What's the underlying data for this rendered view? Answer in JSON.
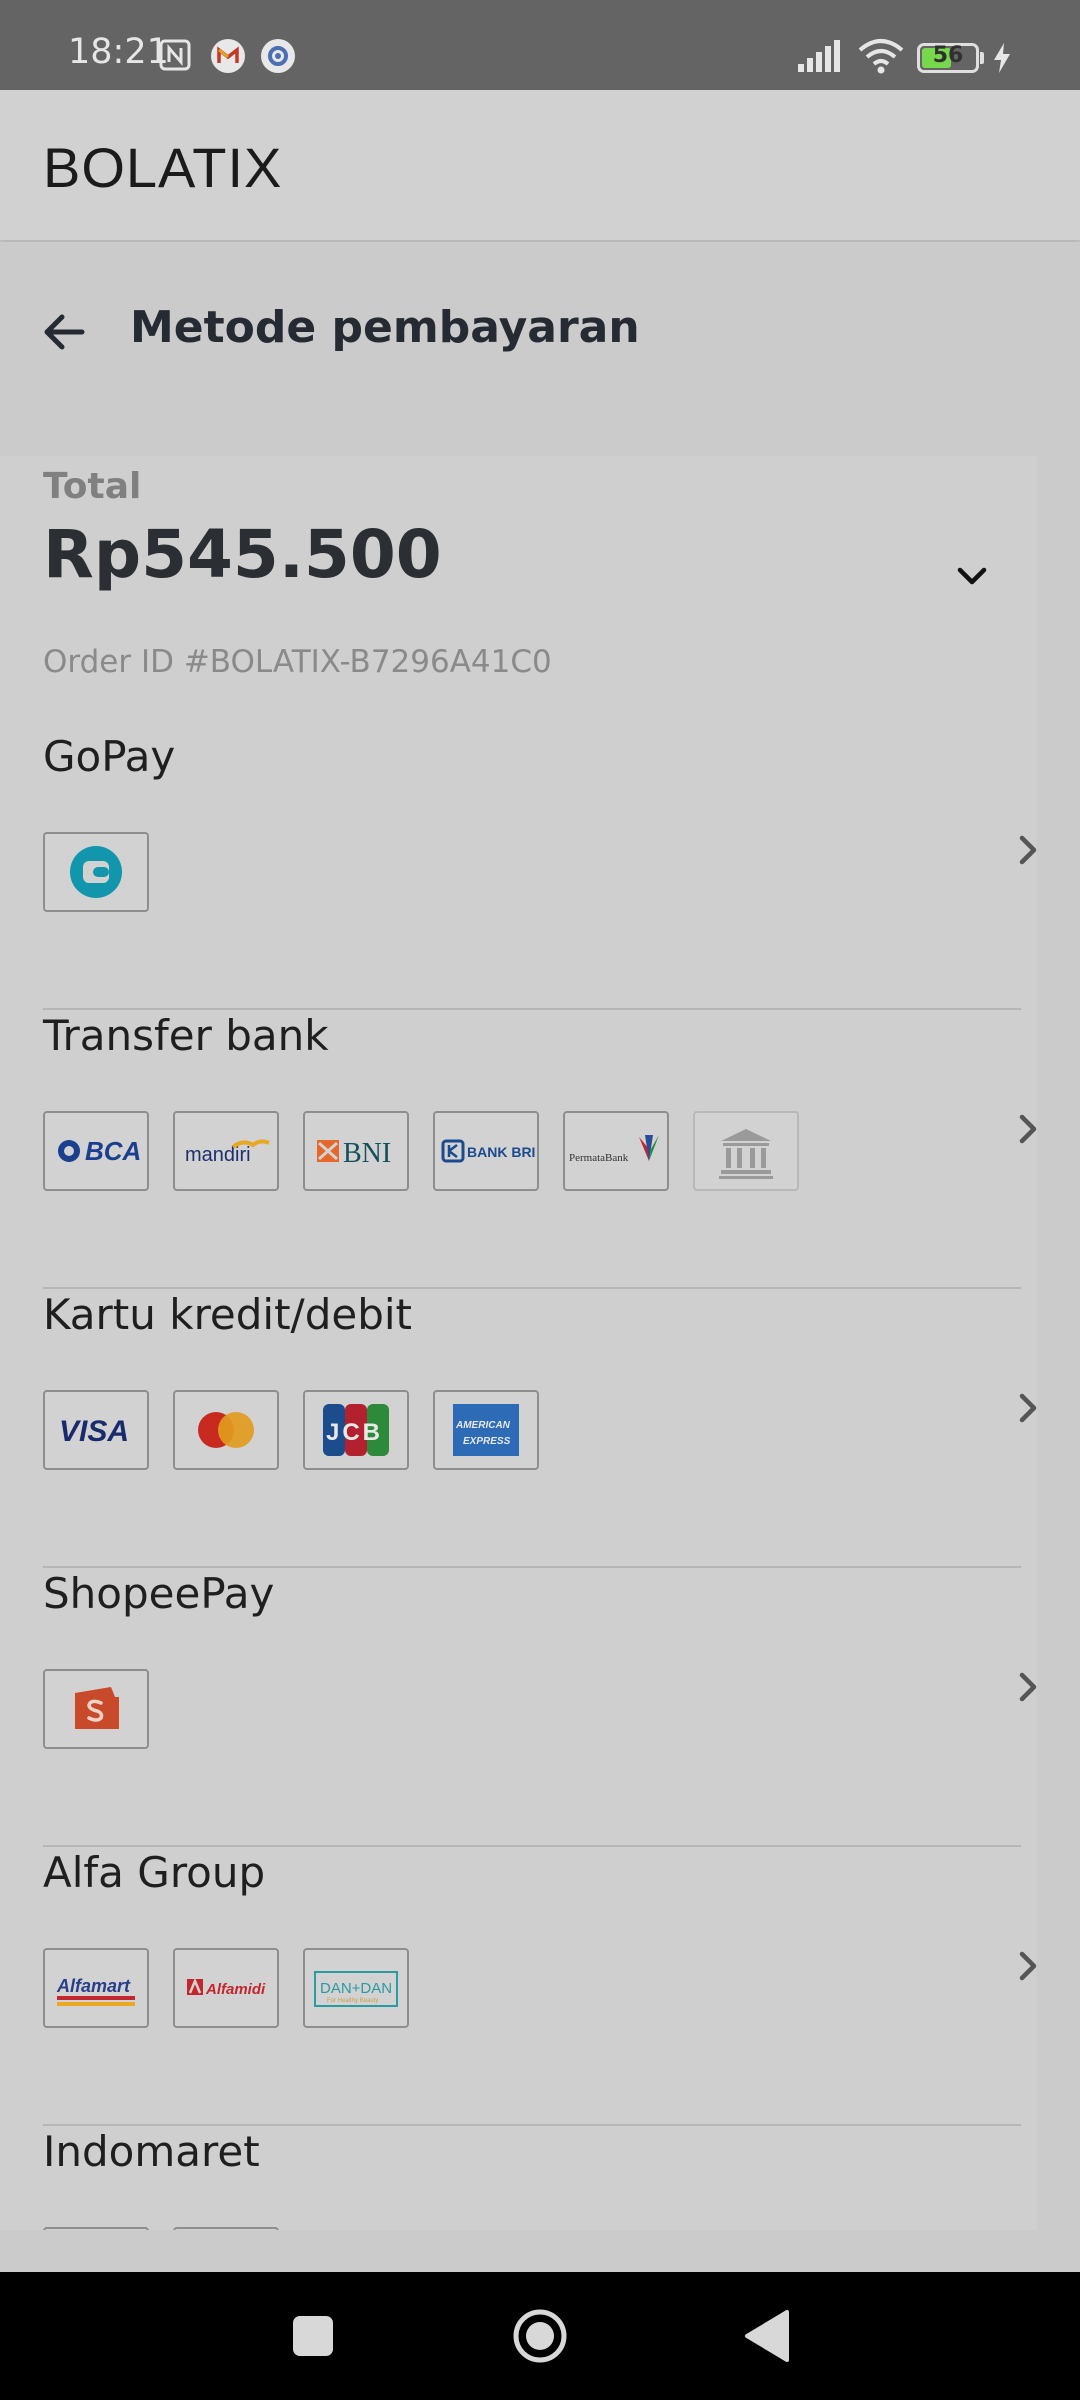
{
  "status_bar": {
    "time": "18:21",
    "battery_percent": "56",
    "battery_level": 0.56,
    "icons": [
      "nfc-icon",
      "gmail-icon",
      "settings-app-icon",
      "signal-icon",
      "wifi-icon",
      "battery-icon",
      "charging-icon"
    ]
  },
  "app_bar": {
    "title": "BOLATIX"
  },
  "page": {
    "title": "Metode pembayaran"
  },
  "summary": {
    "total_label": "Total",
    "total_amount": "Rp545.500",
    "order_id": "Order ID #BOLATIX-B7296A41C0"
  },
  "methods": [
    {
      "title": "GoPay",
      "logos": [
        "gopay"
      ]
    },
    {
      "title": "Transfer bank",
      "logos": [
        "BCA",
        "mandiri",
        "BNI",
        "BANK BRI",
        "PermataBank",
        "other-bank"
      ]
    },
    {
      "title": "Kartu kredit/debit",
      "logos": [
        "VISA",
        "mastercard",
        "JCB",
        "AMERICAN EXPRESS"
      ]
    },
    {
      "title": "ShopeePay",
      "logos": [
        "shopeepay"
      ]
    },
    {
      "title": "Alfa Group",
      "logos": [
        "Alfamart",
        "Alfamidi",
        "DAN+DAN"
      ]
    },
    {
      "title": "Indomaret",
      "logos": []
    }
  ],
  "logo_text": {
    "bca": "BCA",
    "mandiri": "mandiri",
    "bni": "BNI",
    "bri": "BANK BRI",
    "permata": "PermataBank",
    "visa": "VISA",
    "jcb": "JCB",
    "amex_1": "AMERICAN",
    "amex_2": "EXPRESS",
    "alfamart": "Alfamart",
    "alfamidi": "Alfamidi",
    "dandan": "DAN+DAN",
    "dandan_sub": "For Healthy Beauty"
  },
  "colors": {
    "status_bar": "#646464",
    "page_bg": "#cbcbcb",
    "text_dark": "#262a33",
    "muted": "#8a8a8a",
    "gopay": "#1196ab",
    "shopee": "#c84a2a"
  },
  "nav_bar": {
    "buttons": [
      "recents-button",
      "home-button",
      "back-button"
    ]
  }
}
